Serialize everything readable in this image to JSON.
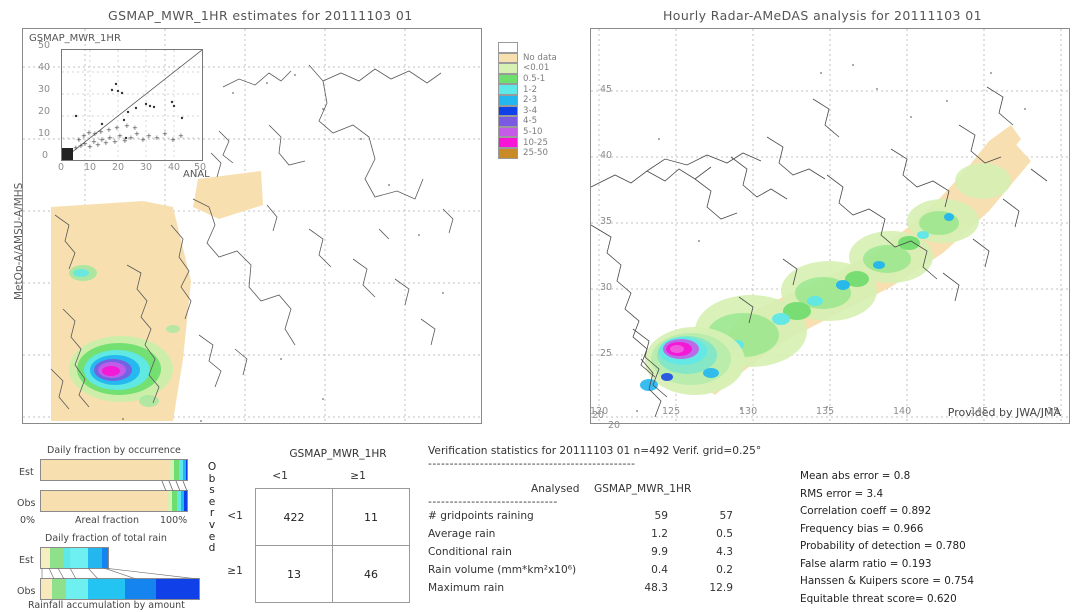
{
  "left_panel": {
    "title": "GSMAP_MWR_1HR estimates for 20111103 01",
    "inset_title": "GSMAP_MWR_1HR",
    "inset_xlabel": "ANAL",
    "inset_yticks": [
      "50",
      "40",
      "30",
      "20",
      "10",
      "0"
    ],
    "inset_xticks": [
      "0",
      "10",
      "20",
      "30",
      "40",
      "50"
    ],
    "yaxis_label": "MetOp-A/AMSU-A/MHS"
  },
  "right_panel": {
    "title": "Hourly Radar-AMeDAS analysis for 20111103 01",
    "credit": "Provided by JWA/JMA",
    "lat_ticks": [
      "45",
      "40",
      "35",
      "30",
      "25",
      "20"
    ],
    "lon_ticks": [
      "120",
      "125",
      "130",
      "135",
      "140",
      "145",
      "15"
    ],
    "corner_label": "20"
  },
  "colorbar": {
    "entries": [
      {
        "label": "",
        "color": "#ffffff"
      },
      {
        "label": "No data",
        "color": "#f7dfb0"
      },
      {
        "label": "<0.01",
        "color": "#d7f0b4"
      },
      {
        "label": "0.5-1",
        "color": "#6ede6e"
      },
      {
        "label": "1-2",
        "color": "#5fe8e8"
      },
      {
        "label": "2-3",
        "color": "#23b6ef"
      },
      {
        "label": "3-4",
        "color": "#1040e8"
      },
      {
        "label": "4-5",
        "color": "#7a5ae0"
      },
      {
        "label": "5-10",
        "color": "#c45ce8"
      },
      {
        "label": "10-25",
        "color": "#f714d6"
      },
      {
        "label": "25-50",
        "color": "#c98a28"
      }
    ]
  },
  "occurrence_chart": {
    "title": "Daily fraction by occurrence",
    "xlabel": "Areal fraction",
    "x_min": "0%",
    "x_max": "100%",
    "rows": [
      {
        "label": "Est",
        "segments": [
          {
            "color": "#f7dfb0",
            "pct": 88.0
          },
          {
            "color": "#d7f0b4",
            "pct": 3.0
          },
          {
            "color": "#6ede6e",
            "pct": 3.5
          },
          {
            "color": "#5fe8e8",
            "pct": 2.5
          },
          {
            "color": "#23b6ef",
            "pct": 2.0
          },
          {
            "color": "#1040e8",
            "pct": 1.0
          }
        ]
      },
      {
        "label": "Obs",
        "segments": [
          {
            "color": "#f7dfb0",
            "pct": 87.0
          },
          {
            "color": "#d7f0b4",
            "pct": 3.0
          },
          {
            "color": "#6ede6e",
            "pct": 3.0
          },
          {
            "color": "#5fe8e8",
            "pct": 3.0
          },
          {
            "color": "#23b6ef",
            "pct": 2.0
          },
          {
            "color": "#1040e8",
            "pct": 2.0
          }
        ]
      }
    ]
  },
  "amount_chart": {
    "title": "Daily fraction of total rain",
    "xlabel": "Rainfall accumulation by amount",
    "rows": [
      {
        "label": "Est",
        "width_pct": 43.0,
        "segments": [
          {
            "color": "#f5eec0",
            "pct": 14.0
          },
          {
            "color": "#8fe08a",
            "pct": 20.0
          },
          {
            "color": "#5fe8e8",
            "pct": 10.0
          },
          {
            "color": "#6ef0f0",
            "pct": 26.0
          },
          {
            "color": "#23b6ef",
            "pct": 22.0
          },
          {
            "color": "#1684ef",
            "pct": 8.0
          }
        ]
      },
      {
        "label": "Obs",
        "width_pct": 100.0,
        "segments": [
          {
            "color": "#f7e9bc",
            "pct": 7.0
          },
          {
            "color": "#8fe08a",
            "pct": 9.0
          },
          {
            "color": "#6ef0f0",
            "pct": 14.0
          },
          {
            "color": "#23c4f2",
            "pct": 23.0
          },
          {
            "color": "#1684ef",
            "pct": 20.0
          },
          {
            "color": "#1040e8",
            "pct": 27.0
          }
        ]
      }
    ]
  },
  "contingency": {
    "title": "GSMAP_MWR_1HR",
    "col_headers": [
      "<1",
      "≥1"
    ],
    "row_headers": [
      "<1",
      "≥1"
    ],
    "side_label": "Observed",
    "cells": [
      [
        "422",
        "11"
      ],
      [
        "13",
        "46"
      ]
    ]
  },
  "verification": {
    "header": "Verification statistics for 20111103 01  n=492  Verif. grid=0.25°",
    "rule": "------------------------------------------------",
    "col_analysed": "Analysed",
    "col_product": "GSMAP_MWR_1HR",
    "rule2": "------------------------------",
    "rows": [
      {
        "name": "# gridpoints raining",
        "analysed": "59",
        "product": "57"
      },
      {
        "name": "Average rain",
        "analysed": "1.2",
        "product": "0.5"
      },
      {
        "name": "Conditional rain",
        "analysed": "9.9",
        "product": "4.3"
      },
      {
        "name": "Rain volume (mm*km²x10⁶)",
        "analysed": "0.4",
        "product": "0.2"
      },
      {
        "name": "Maximum rain",
        "analysed": "48.3",
        "product": "12.9"
      }
    ]
  },
  "scores": [
    "Mean abs error = 0.8",
    "RMS error = 3.4",
    "Correlation coeff = 0.892",
    "Frequency bias = 0.966",
    "Probability of detection = 0.780",
    "False alarm ratio = 0.193",
    "Hanssen & Kuipers score = 0.754",
    "Equitable threat score= 0.620"
  ]
}
